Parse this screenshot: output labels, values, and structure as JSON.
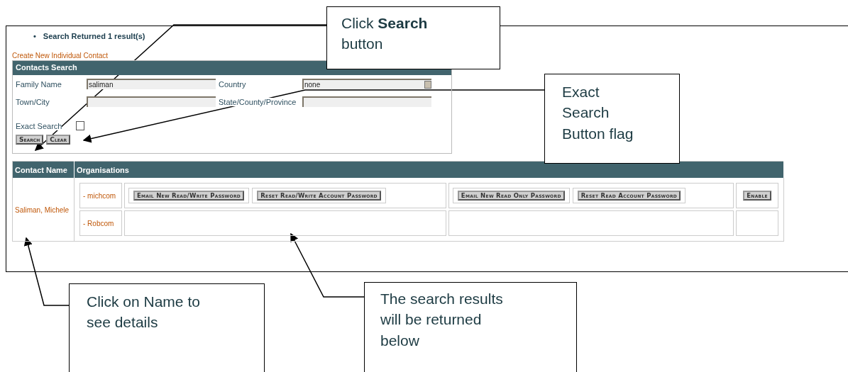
{
  "results_message": {
    "bullet": "•",
    "text": "Search Returned 1 result(s)"
  },
  "create_link": "Create New Individual Contact",
  "search_panel": {
    "title": "Contacts Search",
    "fields": [
      {
        "label": "Family Name",
        "value": "saliman",
        "kind": "text"
      },
      {
        "label": "Country",
        "value": "none",
        "kind": "select"
      },
      {
        "label": "Town/City",
        "kind": "text"
      },
      {
        "label": "State/County/Province",
        "kind": "text"
      }
    ],
    "exact_search": {
      "label": "Exact Search",
      "checked": false
    },
    "buttons": [
      "Search",
      "Clear"
    ]
  },
  "results_table": {
    "columns": [
      "Contact Name",
      "Organisations"
    ],
    "rows": [
      {
        "contact": "Saliman, Michele",
        "organisations": [
          {
            "name": "- michcom",
            "groups": [
              [
                "Email New Read/Write Password",
                "Reset Read/Write Account Password"
              ],
              [
                "Email New Read Only Password",
                "Reset Read Account Password"
              ],
              [
                "Enable"
              ]
            ]
          },
          {
            "name": "- Robcom"
          }
        ]
      }
    ]
  },
  "callouts": [
    {
      "text": "Click **Search** button"
    },
    {
      "text": "Exact Search Button flag"
    },
    {
      "text": "Click on Name to see details"
    },
    {
      "text": "The search results will be returned below"
    }
  ]
}
